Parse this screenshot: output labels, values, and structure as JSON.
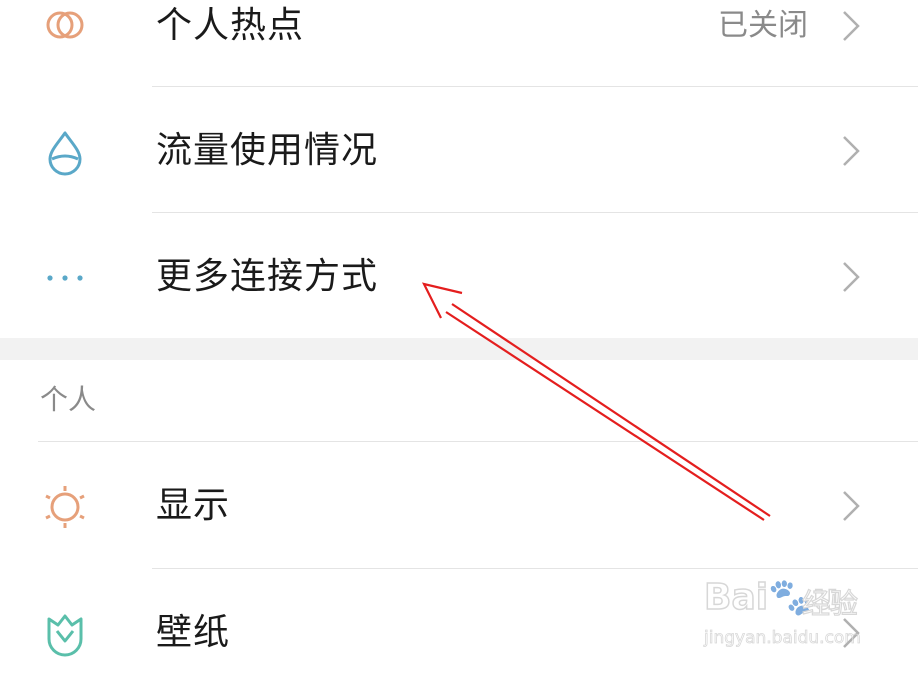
{
  "network": {
    "items": [
      {
        "label": "个人热点",
        "value": "已关闭",
        "icon": "hotspot-rings-icon",
        "icon_color": "#e6a07a"
      },
      {
        "label": "流量使用情况",
        "value": "",
        "icon": "water-drop-icon",
        "icon_color": "#5aa8c8"
      },
      {
        "label": "更多连接方式",
        "value": "",
        "icon": "more-dots-icon",
        "icon_color": "#5aa8c8"
      }
    ]
  },
  "personal": {
    "header": "个人",
    "items": [
      {
        "label": "显示",
        "value": "",
        "icon": "sun-icon",
        "icon_color": "#e6a07a"
      },
      {
        "label": "壁纸",
        "value": "",
        "icon": "tulip-icon",
        "icon_color": "#5abfaa"
      }
    ]
  },
  "watermark": {
    "brand": "Bai🐾u",
    "sub": "经验",
    "url": "jingyan.baidu.com"
  },
  "annotation_color": "#e41e1e"
}
